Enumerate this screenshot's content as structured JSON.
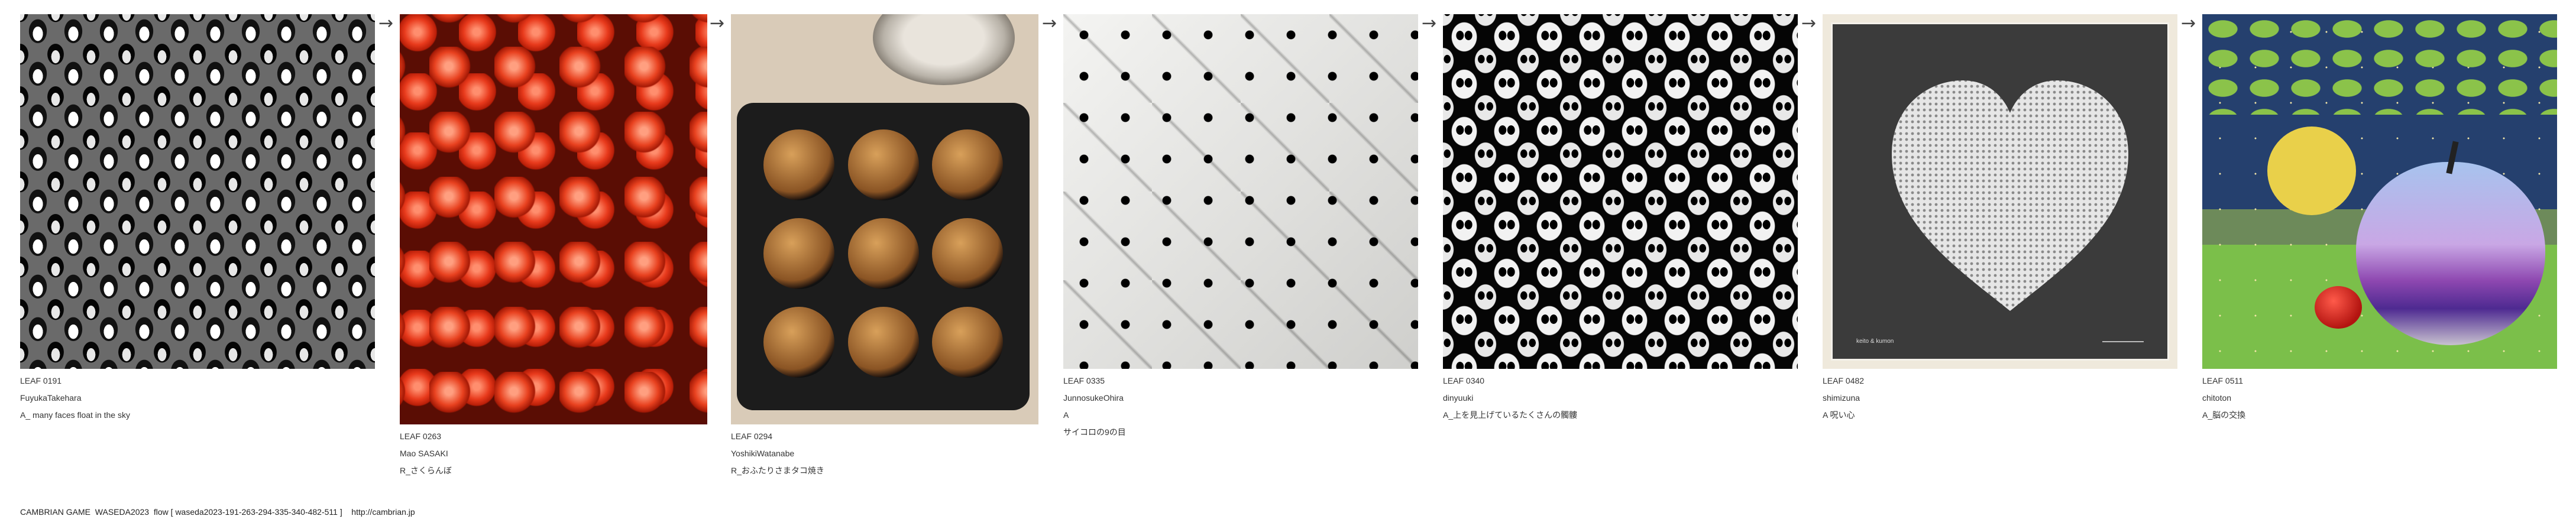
{
  "cards": [
    {
      "leaf": "LEAF 0191",
      "author": "FuyukaTakehara",
      "title": "A_ many faces float in the sky"
    },
    {
      "leaf": "LEAF 0263",
      "author": "Mao SASAKI",
      "title": "R_さくらんぼ"
    },
    {
      "leaf": "LEAF 0294",
      "author": "YoshikiWatanabe",
      "title": "R_おふたりさまタコ焼き"
    },
    {
      "leaf": "LEAF 0335",
      "author": "JunnosukeOhira",
      "title_line1": "A",
      "title_line2": "サイコロの9の目"
    },
    {
      "leaf": "LEAF 0340",
      "author": "dinyuuki",
      "title": "A_上を見上げているたくさんの髑髏"
    },
    {
      "leaf": "LEAF 0482",
      "author": "shimizuna",
      "title": "A 呪い心"
    },
    {
      "leaf": "LEAF 0511",
      "author": "chitoton",
      "title": "A_脳の交換"
    }
  ],
  "arrow_glyph": "→",
  "footer": {
    "game": "CAMBRIAN GAME  WASEDA2023  flow [ waseda2023-191-263-294-335-340-482-511 ]",
    "url": "http://cambrian.jp"
  },
  "scarf_brand": "keito & kumon"
}
